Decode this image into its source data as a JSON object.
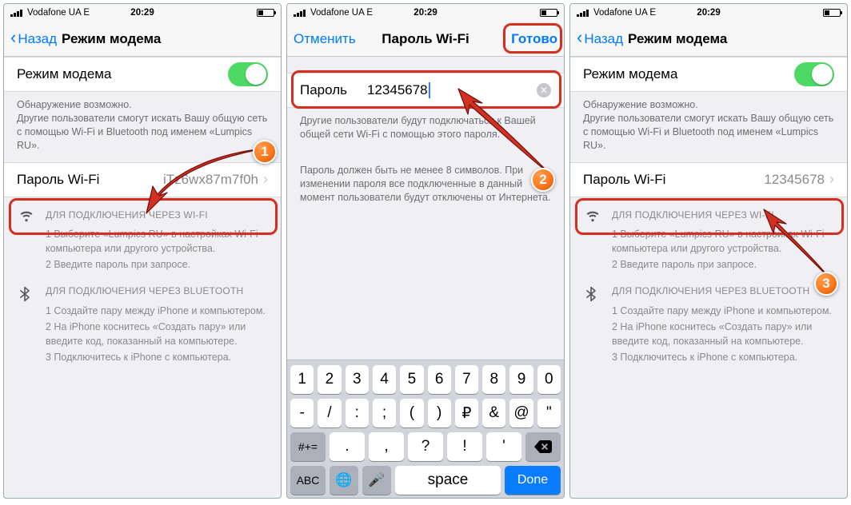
{
  "status": {
    "carrier": "Vodafone UA  E",
    "time": "20:29"
  },
  "screen1": {
    "nav_back": "Назад",
    "nav_title": "Режим модема",
    "toggle_label": "Режим модема",
    "discover_head": "Обнаружение возможно.",
    "discover_body": "Другие пользователи смогут искать Вашу общую сеть с помощью Wi-Fi и Bluetooth под именем «Lumpics RU».",
    "pw_label": "Пароль Wi-Fi",
    "pw_value": "iTz6wx87m7f0h",
    "wifi_head": "ДЛЯ ПОДКЛЮЧЕНИЯ ЧЕРЕЗ WI-FI",
    "wifi_1": "1 Выберите «Lumpics RU» в настройках Wi-Fi компьютера или другого устройства.",
    "wifi_2": "2 Введите пароль при запросе.",
    "bt_head": "ДЛЯ ПОДКЛЮЧЕНИЯ ЧЕРЕЗ BLUETOOTH",
    "bt_1": "1 Создайте пару между iPhone и компьютером.",
    "bt_2": "2 На iPhone коснитесь «Создать пару» или введите код, показанный на компьютере.",
    "bt_3": "3 Подключитесь к iPhone с компьютера."
  },
  "screen2": {
    "nav_cancel": "Отменить",
    "nav_title": "Пароль Wi-Fi",
    "nav_done": "Готово",
    "pw_label": "Пароль",
    "pw_value": "12345678",
    "help_1": "Другие пользователи будут подключаться к Вашей общей сети Wi-Fi с помощью этого пароля.",
    "help_2": "Пароль должен быть не менее 8 символов. При изменении пароля все подключенные в данный момент пользователи будут отключены от Интернета.",
    "kb_r1": [
      "1",
      "2",
      "3",
      "4",
      "5",
      "6",
      "7",
      "8",
      "9",
      "0"
    ],
    "kb_r2": [
      "-",
      "/",
      ":",
      ";",
      "(",
      ")",
      "₽",
      "&",
      "@",
      "\""
    ],
    "kb_r3_alt": "#+=",
    "kb_r3": [
      ".",
      ",",
      "?",
      "!",
      "'"
    ],
    "kb_abc": "ABC",
    "kb_space": "space",
    "kb_done": "Done"
  },
  "screen3": {
    "nav_back": "Назад",
    "nav_title": "Режим модема",
    "toggle_label": "Режим модема",
    "discover_head": "Обнаружение возможно.",
    "discover_body": "Другие пользователи смогут искать Вашу общую сеть с помощью Wi-Fi и Bluetooth под именем «Lumpics RU».",
    "pw_label": "Пароль Wi-Fi",
    "pw_value": "12345678",
    "wifi_head": "ДЛЯ ПОДКЛЮЧЕНИЯ ЧЕРЕЗ WI-FI",
    "wifi_1": "1 Выберите «Lumpics RU» в настройках Wi-Fi компьютера или другого устройства.",
    "wifi_2": "2 Введите пароль при запросе.",
    "bt_head": "ДЛЯ ПОДКЛЮЧЕНИЯ ЧЕРЕЗ BLUETOOTH",
    "bt_1": "1 Создайте пару между iPhone и компьютером.",
    "bt_2": "2 На iPhone коснитесь «Создать пару» или введите код, показанный на компьютере.",
    "bt_3": "3 Подключитесь к iPhone с компьютера."
  },
  "badges": {
    "one": "1",
    "two": "2",
    "three": "3"
  }
}
